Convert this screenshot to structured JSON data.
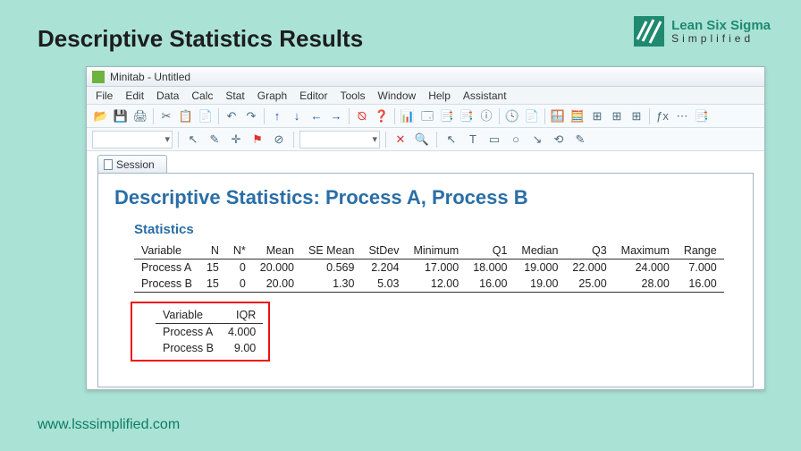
{
  "slide": {
    "title": "Descriptive Statistics Results",
    "brand_line1": "Lean Six Sigma",
    "brand_line2": "Simplified",
    "footer": "www.lsssimplified.com"
  },
  "window": {
    "title": "Minitab - Untitled",
    "menu": [
      "File",
      "Edit",
      "Data",
      "Calc",
      "Stat",
      "Graph",
      "Editor",
      "Tools",
      "Window",
      "Help",
      "Assistant"
    ],
    "session_tab": "Session",
    "result_title": "Descriptive Statistics: Process A, Process B",
    "stats_heading": "Statistics",
    "columns": [
      "Variable",
      "N",
      "N*",
      "Mean",
      "SE Mean",
      "StDev",
      "Minimum",
      "Q1",
      "Median",
      "Q3",
      "Maximum",
      "Range"
    ],
    "rows": [
      {
        "Variable": "Process A",
        "N": "15",
        "Nstar": "0",
        "Mean": "20.000",
        "SEMean": "0.569",
        "StDev": "2.204",
        "Minimum": "17.000",
        "Q1": "18.000",
        "Median": "19.000",
        "Q3": "22.000",
        "Maximum": "24.000",
        "Range": "7.000"
      },
      {
        "Variable": "Process B",
        "N": "15",
        "Nstar": "0",
        "Mean": "20.00",
        "SEMean": "1.30",
        "StDev": "5.03",
        "Minimum": "12.00",
        "Q1": "16.00",
        "Median": "19.00",
        "Q3": "25.00",
        "Maximum": "28.00",
        "Range": "16.00"
      }
    ],
    "iqr_columns": [
      "Variable",
      "IQR"
    ],
    "iqr_rows": [
      {
        "Variable": "Process A",
        "IQR": "4.000"
      },
      {
        "Variable": "Process B",
        "IQR": "9.00"
      }
    ]
  },
  "toolbar_icons_row1": [
    "📂",
    "💾",
    "🖨",
    "✂",
    "📋",
    "📄",
    "↶",
    "↷",
    "↑",
    "↓",
    "←",
    "→",
    "⦰",
    "❓",
    "📊",
    "🗔",
    "📑",
    "📑",
    "ⓘ",
    "🕓",
    "📄",
    "🪟",
    "🧮",
    "⊞",
    "⊞",
    "⊞",
    "ƒx",
    "⋯",
    "📑"
  ],
  "toolbar_icons_row2": [
    "▭",
    "⌕",
    "↖",
    "T",
    "□",
    "○",
    "↘",
    "⟲",
    "✎"
  ]
}
